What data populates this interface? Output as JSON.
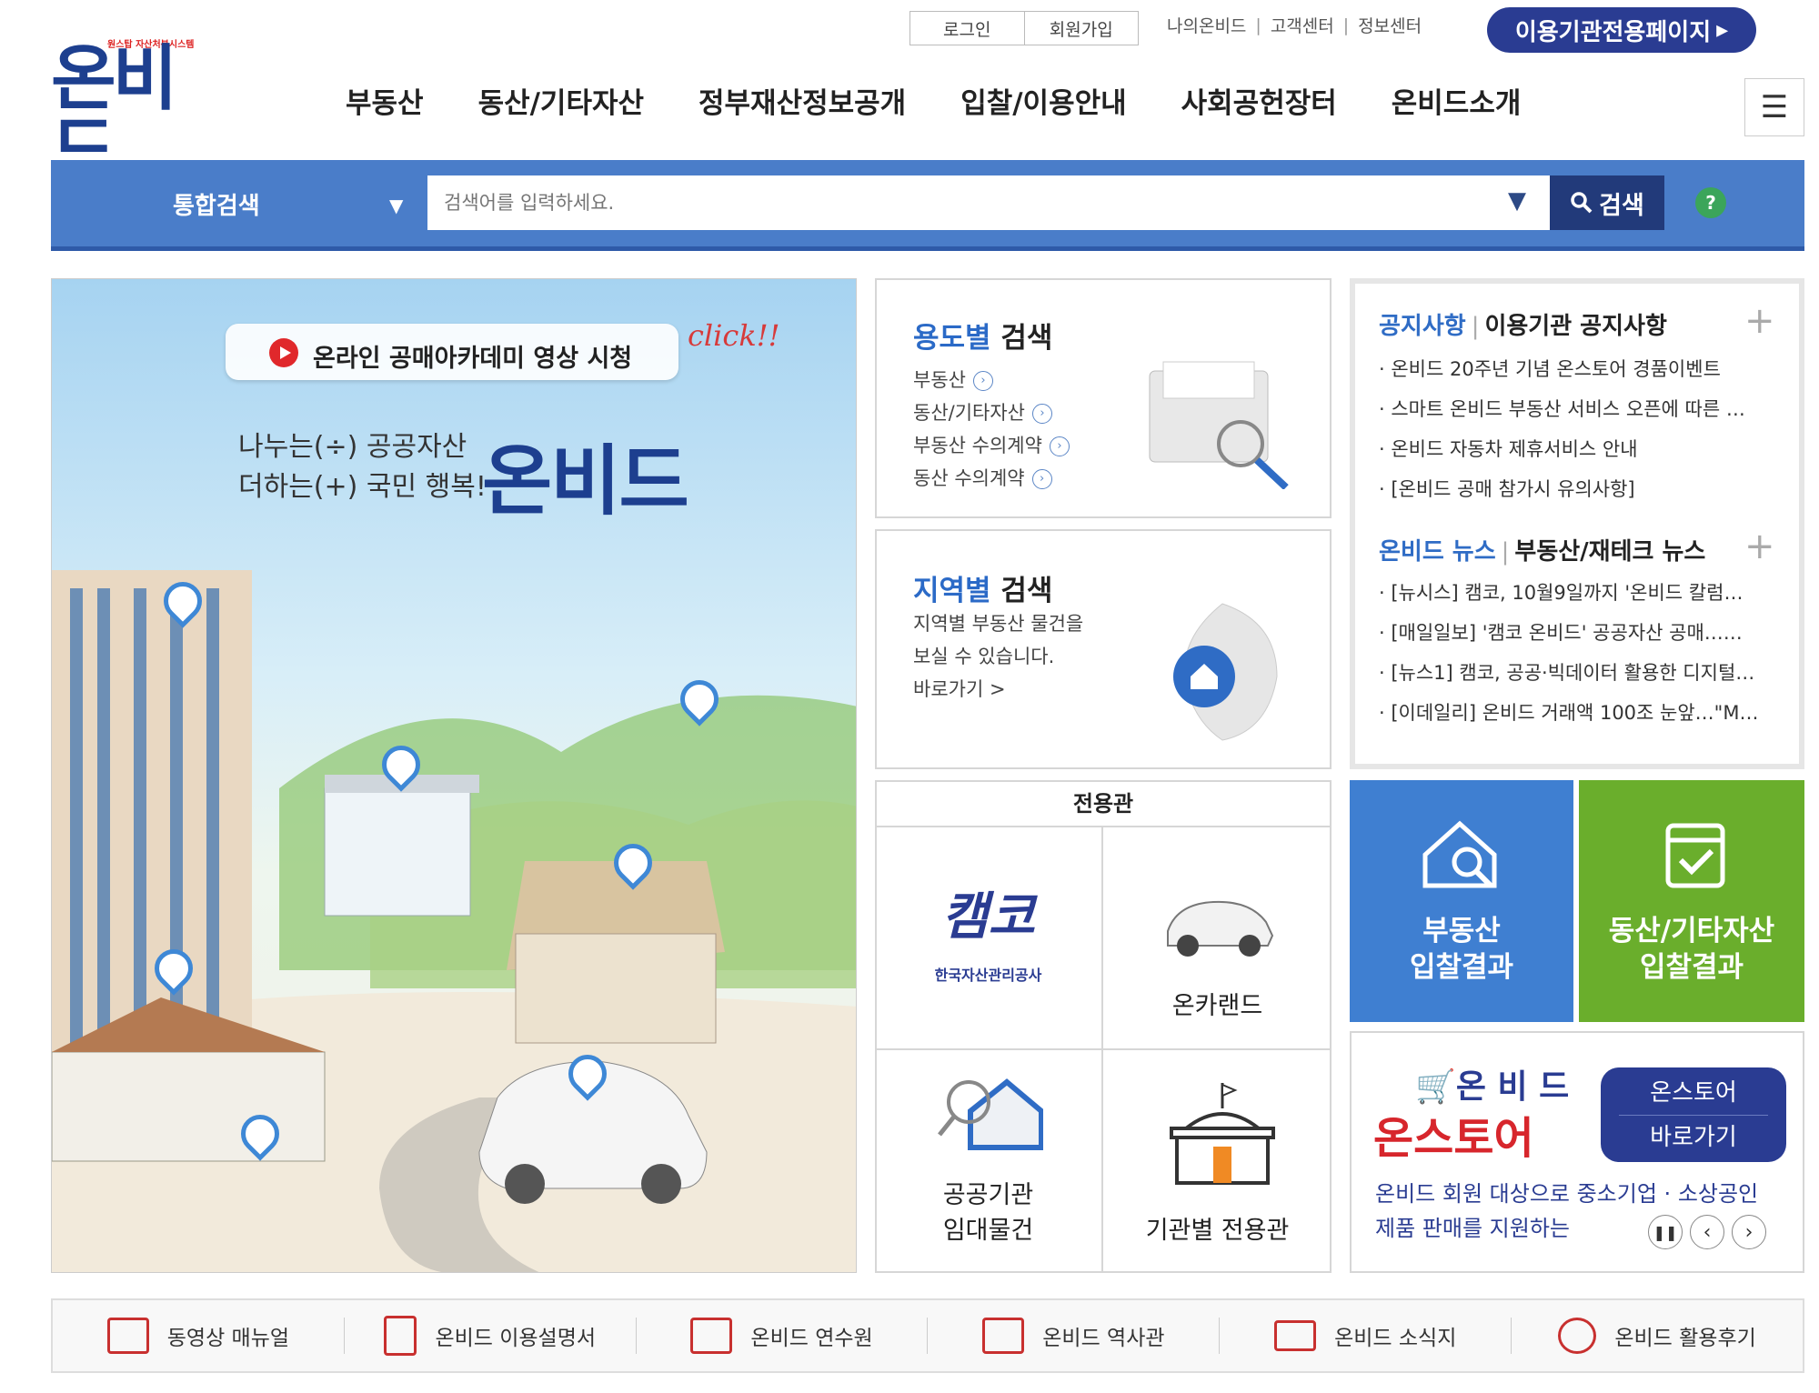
{
  "util": {
    "login": "로그인",
    "join": "회원가입",
    "my": "나의온비드",
    "cs": "고객센터",
    "info": "정보센터",
    "org_page": "이용기관전용페이지"
  },
  "logo": {
    "sub": "원스탑 자산처분시스템",
    "main": "온비드"
  },
  "gnb": [
    "부동산",
    "동산/기타자산",
    "정부재산정보공개",
    "입찰/이용안내",
    "사회공헌장터",
    "온비드소개"
  ],
  "search": {
    "category": "통합검색",
    "placeholder": "검색어를 입력하세요.",
    "button": "검색",
    "help": "?"
  },
  "hero": {
    "academy": "온라인 공매아카데미 영상 시청",
    "click": "click!!",
    "slogan1": "나누는(÷) 공공자산",
    "slogan2": "더하는(+) 국민 행복!",
    "logo": "온비드"
  },
  "usage_search": {
    "title_b": "용도별",
    "title": "검색",
    "items": [
      "부동산",
      "동산/기타자산",
      "부동산 수의계약",
      "동산 수의계약"
    ]
  },
  "region_search": {
    "title_b": "지역별",
    "title": "검색",
    "desc1": "지역별 부동산 물건을",
    "desc2": "보실 수 있습니다.",
    "link": "바로가기 >"
  },
  "notice": {
    "tab1": "공지사항",
    "tab1b": "이용기관 공지사항",
    "items1": [
      "· 온비드 20주년 기념 온스토어 경품이벤트",
      "· 스마트 온비드 부동산 서비스 오픈에 따른 …",
      "· 온비드 자동차 제휴서비스 안내",
      "· [온비드 공매 참가시 유의사항]"
    ],
    "tab2": "온비드 뉴스",
    "tab2b": "부동산/재테크 뉴스",
    "items2": [
      "· [뉴시스] 캠코, 10월9일까지 '온비드 칼럼…",
      "· [매일일보] '캠코 온비드' 공공자산 공매……",
      "· [뉴스1] 캠코, 공공·빅데이터 활용한 디지털…",
      "· [이데일리] 온비드 거래액 100조 눈앞…\"M…"
    ]
  },
  "dedicated": {
    "title": "전용관",
    "kamco": "캠코",
    "kamco_sub": "한국자산관리공사",
    "oncar": "온카랜드",
    "public1": "공공기관",
    "public2": "임대물건",
    "agency": "기관별 전용관"
  },
  "tiles": {
    "re1": "부동산",
    "re2": "입찰결과",
    "mv1": "동산/기타자산",
    "mv2": "입찰결과",
    "re_color": "#3f7fd1",
    "mv_color": "#6aae2c"
  },
  "store": {
    "brand1": "온 비 드",
    "brand2": "온스토어",
    "btn1": "온스토어",
    "btn2": "바로가기",
    "desc1": "온비드 회원 대상으로 중소기업 · 소상공인",
    "desc2": "제품 판매를 지원하는"
  },
  "bottom": [
    "동영상 매뉴얼",
    "온비드 이용설명서",
    "온비드 연수원",
    "온비드 역사관",
    "온비드 소식지",
    "온비드 활용후기"
  ]
}
